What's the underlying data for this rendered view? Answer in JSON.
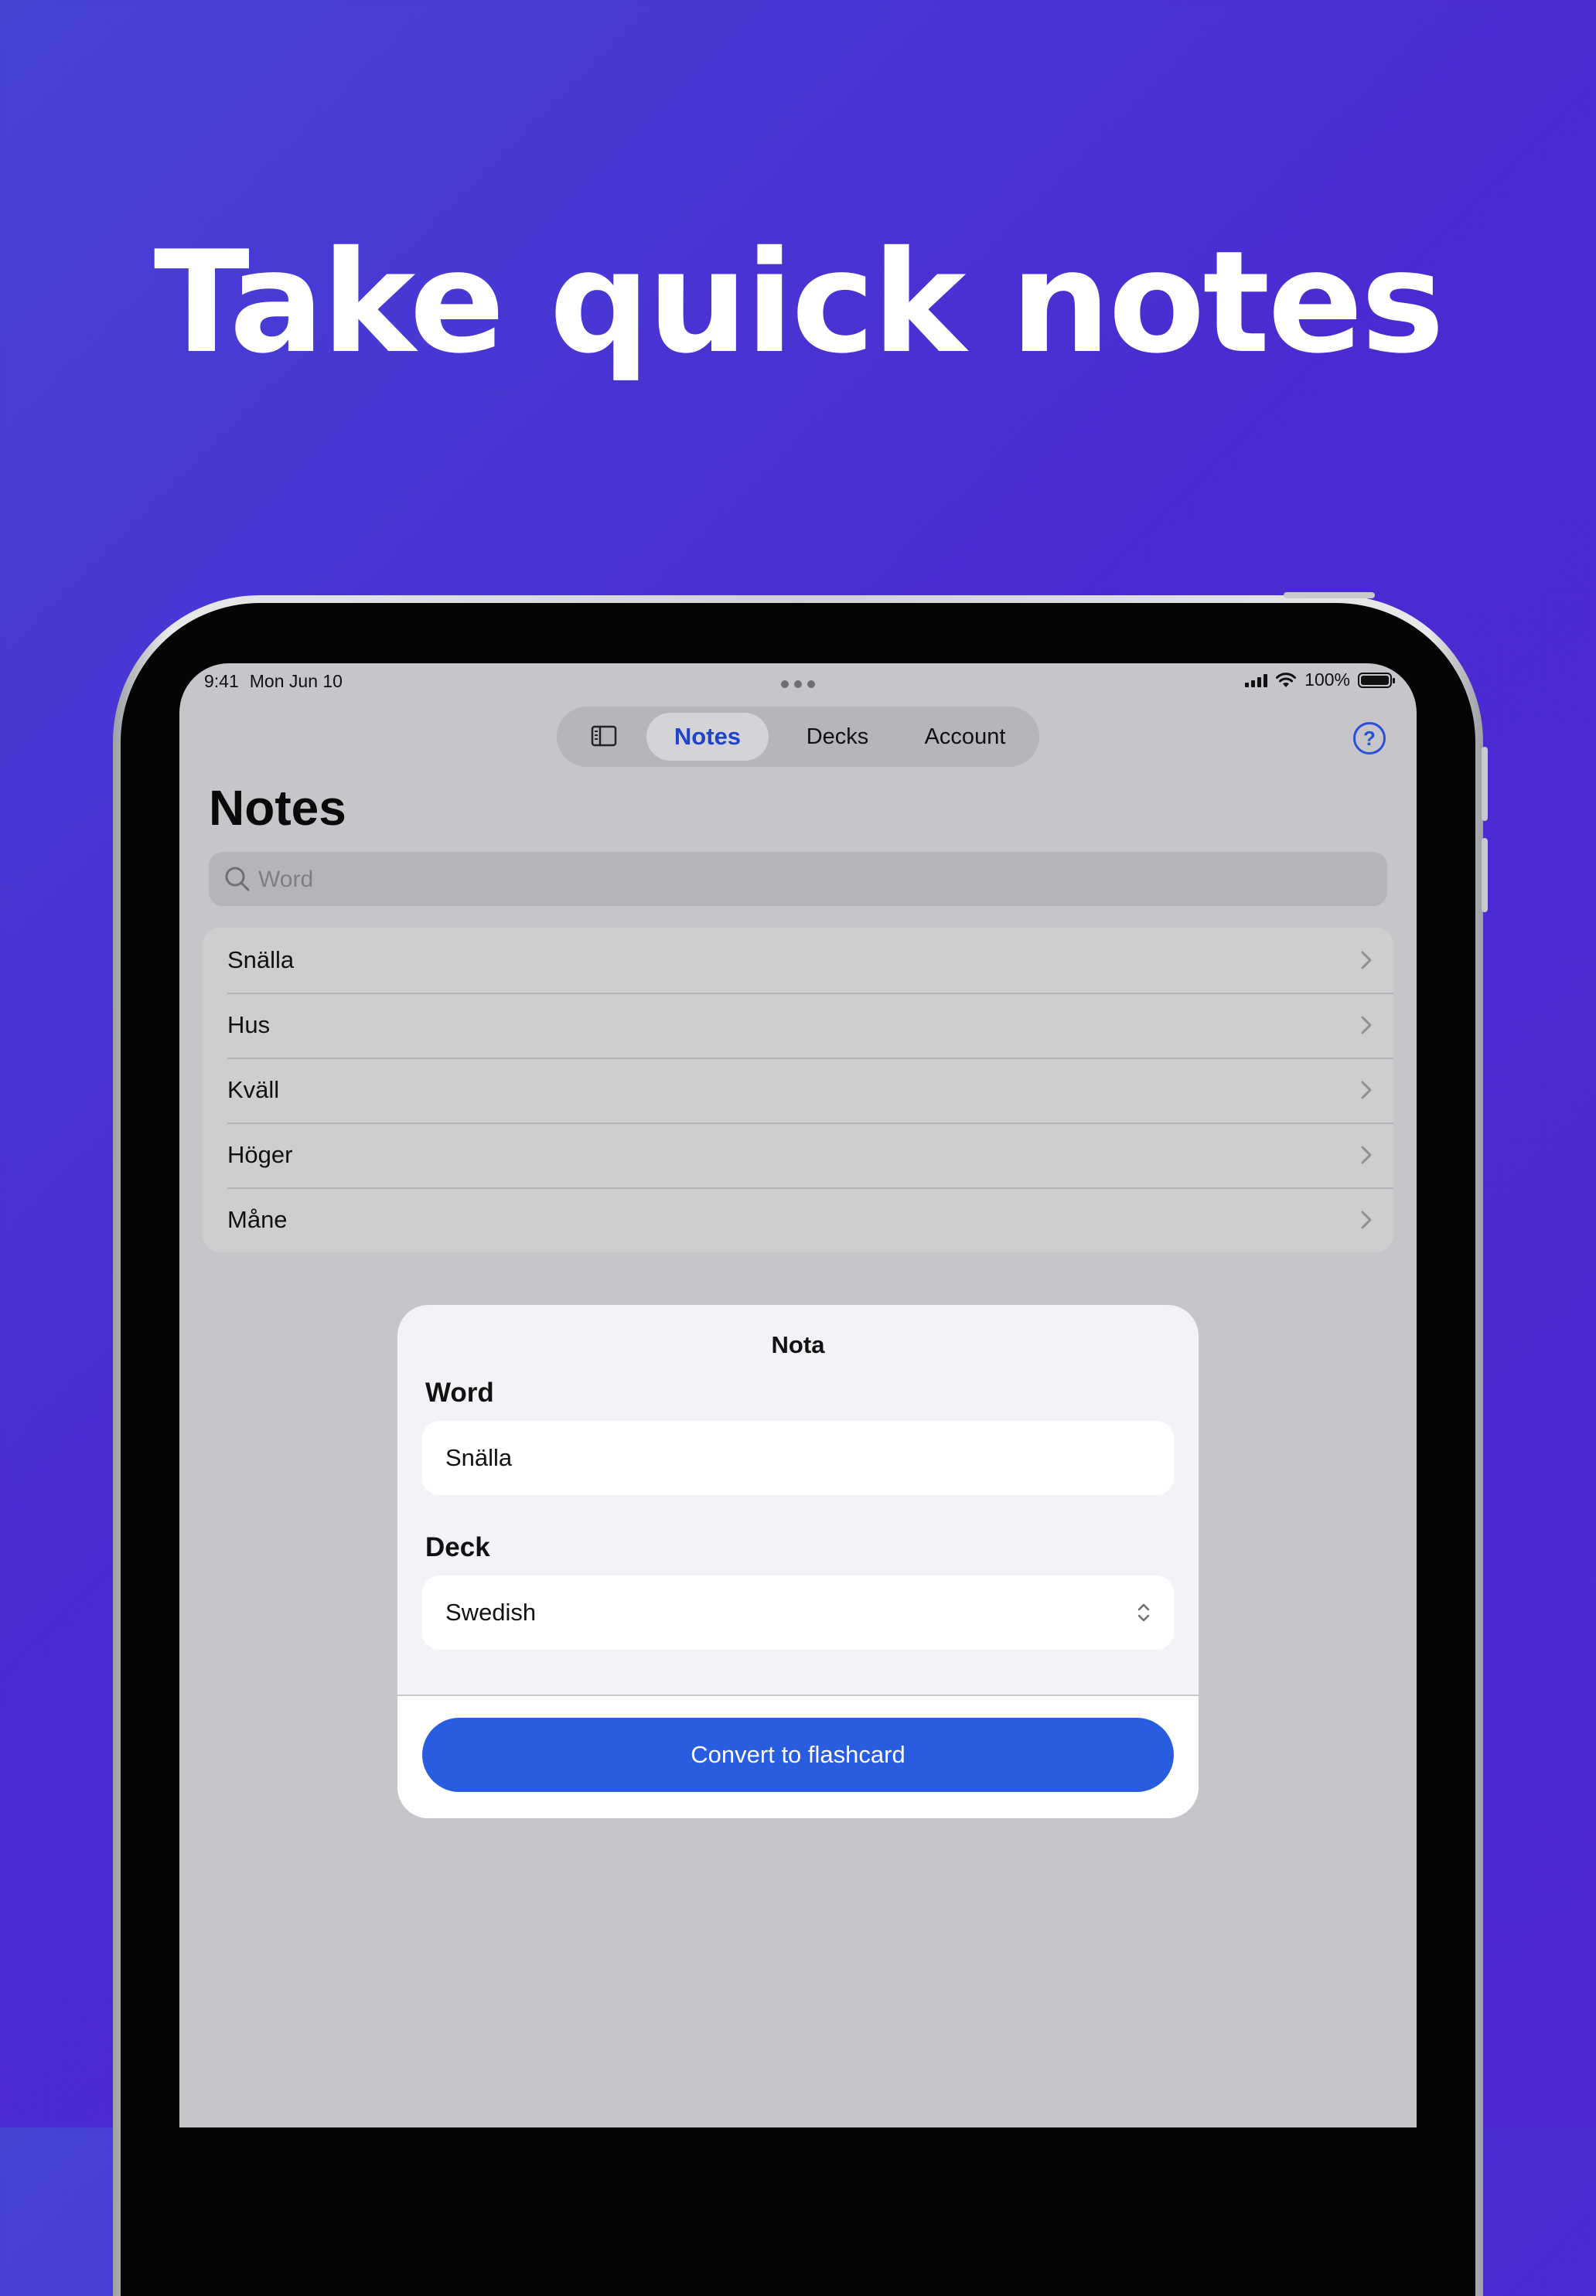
{
  "headline": "Take quick notes",
  "status_bar": {
    "time": "9:41",
    "date": "Mon Jun 10",
    "battery": "100%"
  },
  "tabs": [
    {
      "label": "Notes",
      "active": true
    },
    {
      "label": "Decks",
      "active": false
    },
    {
      "label": "Account",
      "active": false
    }
  ],
  "help": {
    "glyph": "?"
  },
  "page": {
    "title": "Notes"
  },
  "search": {
    "placeholder": "Word"
  },
  "notes": [
    "Snälla",
    "Hus",
    "Kväll",
    "Höger",
    "Måne"
  ],
  "dialog": {
    "title": "Nota",
    "word_label": "Word",
    "word_value": "Snälla",
    "deck_label": "Deck",
    "deck_value": "Swedish",
    "convert_label": "Convert to flashcard"
  },
  "colors": {
    "background": "#4b2bd1",
    "accent": "#285de0",
    "active_tab_text": "#1f44c8"
  }
}
